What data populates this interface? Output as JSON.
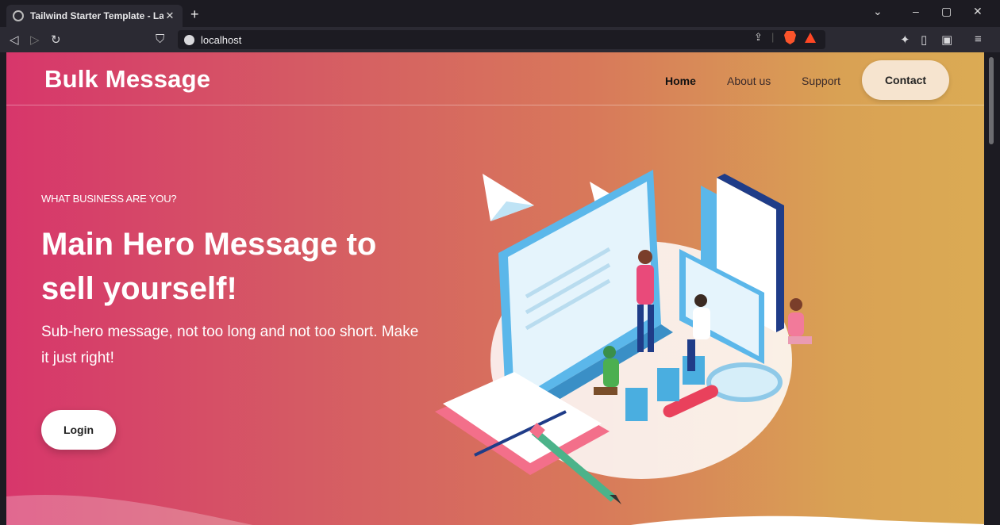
{
  "browser": {
    "tab_title": "Tailwind Starter Template - Landir",
    "tab_close": "✕",
    "new_tab": "+",
    "url": "localhost",
    "window_controls": {
      "menu": "⌄",
      "minimize": "–",
      "restore": "▢",
      "close": "✕"
    }
  },
  "nav": {
    "brand": "Bulk Message",
    "items": [
      {
        "label": "Home"
      },
      {
        "label": "About us"
      },
      {
        "label": "Support"
      }
    ],
    "cta": "Contact"
  },
  "hero": {
    "eyebrow": "WHAT BUSINESS ARE YOU?",
    "title": "Main Hero Message to sell yourself!",
    "subtitle": "Sub-hero message, not too long and not too short. Make it just right!",
    "button": "Login"
  },
  "colors": {
    "gradient_start": "#d7366b",
    "gradient_end": "#dbab54",
    "contact_bg": "#f6e4cf"
  }
}
